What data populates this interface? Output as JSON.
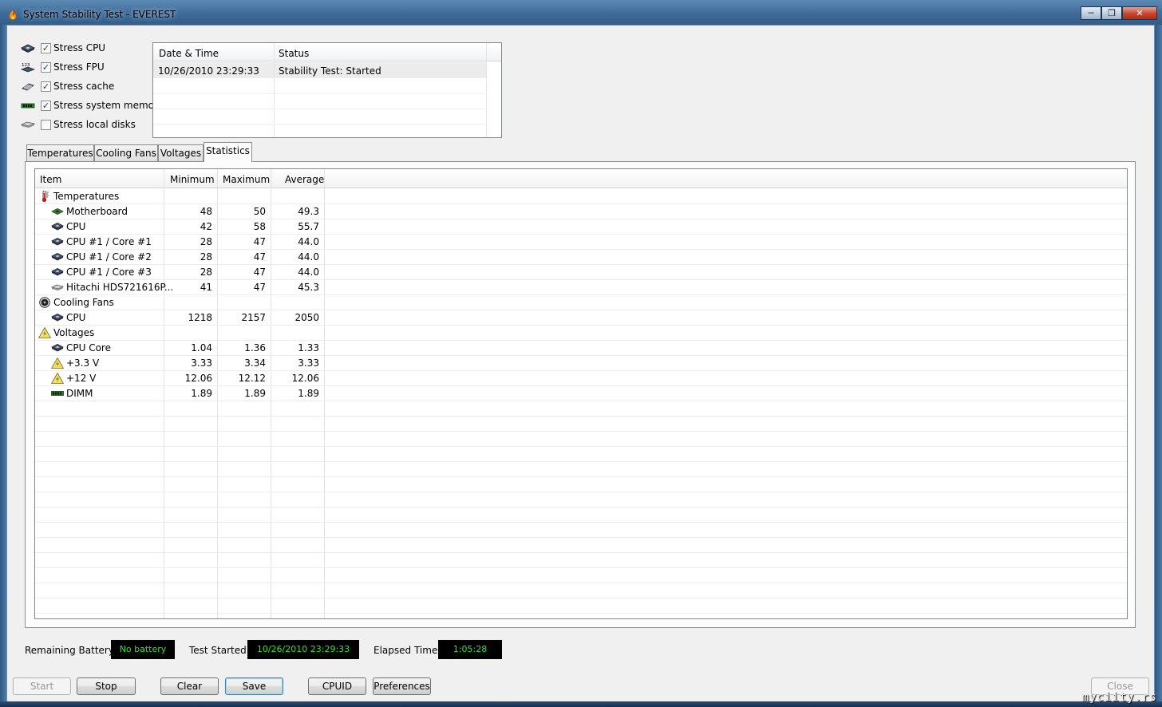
{
  "window": {
    "title": "System Stability Test - EVEREST",
    "minimize_glyph": "─",
    "maximize_glyph": "❐",
    "close_glyph": "✕"
  },
  "stress_options": [
    {
      "label": "Stress CPU",
      "checked": true,
      "icon": "cpu-chip-icon"
    },
    {
      "label": "Stress FPU",
      "checked": true,
      "icon": "fpu-icon"
    },
    {
      "label": "Stress cache",
      "checked": true,
      "icon": "cache-icon"
    },
    {
      "label": "Stress system memory",
      "checked": true,
      "icon": "memory-module-icon"
    },
    {
      "label": "Stress local disks",
      "checked": false,
      "icon": "hard-disk-icon"
    }
  ],
  "log": {
    "columns": [
      "Date & Time",
      "Status"
    ],
    "rows": [
      {
        "datetime": "10/26/2010 23:29:33",
        "status": "Stability Test: Started"
      }
    ]
  },
  "tabs": [
    {
      "label": "Temperatures",
      "active": false
    },
    {
      "label": "Cooling Fans",
      "active": false
    },
    {
      "label": "Voltages",
      "active": false
    },
    {
      "label": "Statistics",
      "active": true
    }
  ],
  "statistics": {
    "columns": [
      "Item",
      "Minimum",
      "Maximum",
      "Average"
    ],
    "rows": [
      {
        "type": "group",
        "label": "Temperatures",
        "icon": "thermometer-icon"
      },
      {
        "type": "item",
        "label": "Motherboard",
        "min": "48",
        "max": "50",
        "avg": "49.3",
        "icon": "motherboard-icon"
      },
      {
        "type": "item",
        "label": "CPU",
        "min": "42",
        "max": "58",
        "avg": "55.7",
        "icon": "cpu-chip-icon"
      },
      {
        "type": "item",
        "label": "CPU #1 / Core #1",
        "min": "28",
        "max": "47",
        "avg": "44.0",
        "icon": "cpu-chip-icon"
      },
      {
        "type": "item",
        "label": "CPU #1 / Core #2",
        "min": "28",
        "max": "47",
        "avg": "44.0",
        "icon": "cpu-chip-icon"
      },
      {
        "type": "item",
        "label": "CPU #1 / Core #3",
        "min": "28",
        "max": "47",
        "avg": "44.0",
        "icon": "cpu-chip-icon"
      },
      {
        "type": "item",
        "label": "Hitachi HDS721616P...",
        "min": "41",
        "max": "47",
        "avg": "45.3",
        "icon": "hard-disk-icon"
      },
      {
        "type": "group",
        "label": "Cooling Fans",
        "icon": "fan-icon"
      },
      {
        "type": "item",
        "label": "CPU",
        "min": "1218",
        "max": "2157",
        "avg": "2050",
        "icon": "cpu-chip-icon"
      },
      {
        "type": "group",
        "label": "Voltages",
        "icon": "voltage-warning-icon"
      },
      {
        "type": "item",
        "label": "CPU Core",
        "min": "1.04",
        "max": "1.36",
        "avg": "1.33",
        "icon": "cpu-chip-icon"
      },
      {
        "type": "item",
        "label": "+3.3 V",
        "min": "3.33",
        "max": "3.34",
        "avg": "3.33",
        "icon": "voltage-warning-icon"
      },
      {
        "type": "item",
        "label": "+12 V",
        "min": "12.06",
        "max": "12.12",
        "avg": "12.06",
        "icon": "voltage-warning-icon"
      },
      {
        "type": "item",
        "label": "DIMM",
        "min": "1.89",
        "max": "1.89",
        "avg": "1.89",
        "icon": "memory-module-icon"
      }
    ]
  },
  "status_bar": {
    "battery_label": "Remaining Battery:",
    "battery_value": "No battery",
    "started_label": "Test Started:",
    "started_value": "10/26/2010 23:29:33",
    "elapsed_label": "Elapsed Time:",
    "elapsed_value": "1:05:28",
    "value_color": "#2ee62e"
  },
  "buttons": {
    "start": "Start",
    "stop": "Stop",
    "clear": "Clear",
    "save": "Save",
    "cpuid": "CPUID",
    "preferences": "Preferences",
    "close": "Close"
  },
  "watermark": "myciity.rs"
}
